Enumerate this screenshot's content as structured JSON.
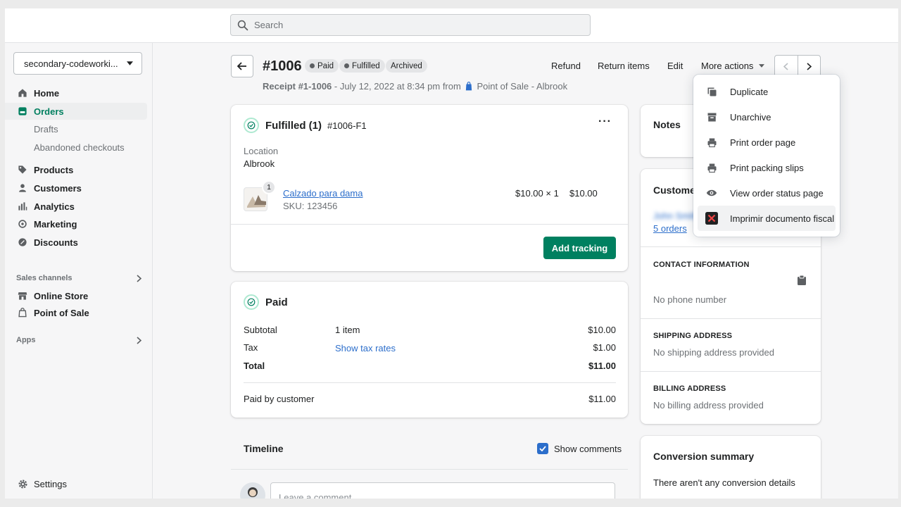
{
  "search": {
    "placeholder": "Search"
  },
  "sidebar": {
    "store_name": "secondary-codeworki...",
    "items": [
      {
        "label": "Home",
        "icon": "home-icon"
      },
      {
        "label": "Orders",
        "icon": "orders-icon",
        "active": true
      },
      {
        "label": "Drafts",
        "sub": true
      },
      {
        "label": "Abandoned checkouts",
        "sub": true
      },
      {
        "label": "Products",
        "icon": "tag-icon"
      },
      {
        "label": "Customers",
        "icon": "person-icon"
      },
      {
        "label": "Analytics",
        "icon": "bar-chart-icon"
      },
      {
        "label": "Marketing",
        "icon": "target-icon"
      },
      {
        "label": "Discounts",
        "icon": "discount-icon"
      }
    ],
    "sales_channels_title": "Sales channels",
    "channels": [
      {
        "label": "Online Store",
        "icon": "store-icon"
      },
      {
        "label": "Point of Sale",
        "icon": "pos-icon"
      }
    ],
    "apps_title": "Apps",
    "settings_label": "Settings"
  },
  "order": {
    "title": "#1006",
    "badges": [
      "Paid",
      "Fulfilled",
      "Archived"
    ],
    "receipt": "Receipt #1-1006",
    "date_text": " - July 12, 2022 at 8:34 pm from ",
    "channel": "Point of Sale - Albrook"
  },
  "actions": {
    "refund": "Refund",
    "return_items": "Return items",
    "edit": "Edit",
    "more_actions": "More actions"
  },
  "fulfilled_card": {
    "title": "Fulfilled (1)",
    "id": "#1006-F1",
    "location_label": "Location",
    "location_value": "Albrook",
    "product_name": "Calzado para dama",
    "sku": "SKU: 123456",
    "quantity": "1",
    "unit_price": "$10.00 × 1",
    "line_total": "$10.00",
    "add_tracking": "Add tracking"
  },
  "paid_card": {
    "title": "Paid",
    "subtotal_label": "Subtotal",
    "subtotal_items": "1 item",
    "subtotal_value": "$10.00",
    "tax_label": "Tax",
    "tax_link": "Show tax rates",
    "tax_value": "$1.00",
    "total_label": "Total",
    "total_value": "$11.00",
    "paid_by_label": "Paid by customer",
    "paid_by_value": "$11.00"
  },
  "timeline": {
    "title": "Timeline",
    "show_comments": "Show comments",
    "comment_placeholder": "Leave a comment..."
  },
  "notes": {
    "title": "Notes"
  },
  "customer": {
    "title": "Customer",
    "name": "John Smith",
    "orders": "5 orders",
    "contact_title": "CONTACT INFORMATION",
    "phone": "No phone number",
    "shipping_title": "SHIPPING ADDRESS",
    "shipping": "No shipping address provided",
    "billing_title": "BILLING ADDRESS",
    "billing": "No billing address provided"
  },
  "conversion": {
    "title": "Conversion summary",
    "text": "There aren't any conversion details"
  },
  "dropdown": {
    "items": [
      {
        "label": "Duplicate",
        "icon": "duplicate-icon"
      },
      {
        "label": "Unarchive",
        "icon": "archive-icon"
      },
      {
        "label": "Print order page",
        "icon": "printer-icon"
      },
      {
        "label": "Print packing slips",
        "icon": "printer-icon"
      },
      {
        "label": "View order status page",
        "icon": "eye-icon"
      },
      {
        "label": "Imprimir documento fiscal",
        "icon": "fiscal-app-icon"
      }
    ]
  },
  "colors": {
    "primary": "#008060",
    "link": "#2c6ecb",
    "active_nav": "#007f5f"
  }
}
